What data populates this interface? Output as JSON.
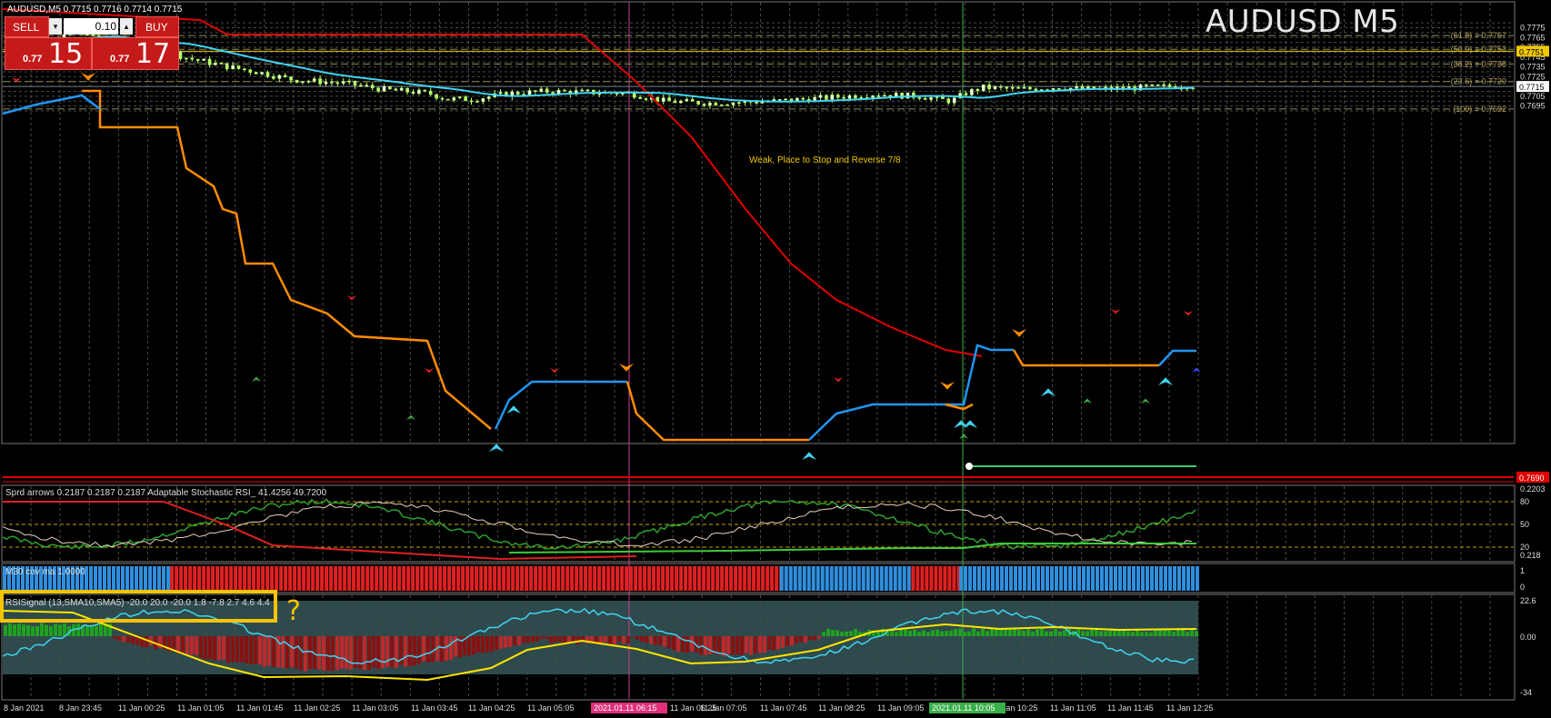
{
  "window": {
    "symbol_line": "AUDUSD,M5  0.7715 0.7716 0.7714 0.7715",
    "watermark": "AUDUSD M5"
  },
  "trade_panel": {
    "sell_label": "SELL",
    "buy_label": "BUY",
    "lot_value": "0.10",
    "sell_price_prefix": "0.77",
    "sell_price_big": "15",
    "buy_price_prefix": "0.77",
    "buy_price_big": "17"
  },
  "main_chart": {
    "price_labels": [
      "0.7775",
      "0.7765",
      "0.7755",
      "0.7745",
      "0.7735",
      "0.7725",
      "0.7705",
      "0.7695"
    ],
    "fib_levels": [
      {
        "text": "(61.8) = 0.7767",
        "price": 0.7767
      },
      {
        "text": "(50.0) = 0.7753",
        "price": 0.7753
      },
      {
        "text": "(38.2) = 0.7738",
        "price": 0.7738
      },
      {
        "text": "(23.6) = 0.7720",
        "price": 0.772
      },
      {
        "text": "(100) = 0.7692",
        "price": 0.7692
      }
    ],
    "current_price": "0.7715",
    "yellow_level": "0.7751",
    "red_level": "0.7690",
    "annotation": "Weak, Place to Stop and Reverse  7/8",
    "colors": {
      "ma_red": "#e00000",
      "ma_cyan": "#3fd4f2",
      "step_orange": "#ff8c00",
      "step_blue": "#2196f3",
      "candle": "#b5ff6a",
      "grid": "#4a4a4a",
      "fib": "#8c8c55",
      "yellow": "#f0c800"
    }
  },
  "stoch": {
    "label": "Sprd arrows 0.2187 0.2187 0.2187  Adaptable Stochastic RSI_ 41.4256 49.7200",
    "axis": [
      "0.2203",
      "80",
      "50",
      "20",
      "0.218"
    ]
  },
  "cov": {
    "label": "M30 cov ma 1.0000",
    "axis": [
      "1",
      "0"
    ],
    "segments": [
      {
        "color": "blue",
        "frac": 0.14
      },
      {
        "color": "red",
        "frac": 0.51
      },
      {
        "color": "blue",
        "frac": 0.11
      },
      {
        "color": "red",
        "frac": 0.04
      },
      {
        "color": "blue",
        "frac": 0.2
      }
    ]
  },
  "rsi": {
    "label": "RSISignal (13,SMA10,SMA5) -20.0 20.0 -20.0 1.8 -7.8 2.7 4.6 4.4",
    "axis": [
      "22.6",
      "0.00",
      "-34"
    ],
    "callout_mark": "?"
  },
  "time_axis": {
    "labels": [
      "8 Jan 2021",
      "8 Jan 23:45",
      "11 Jan 00:25",
      "11 Jan 01:05",
      "11 Jan 01:45",
      "11 Jan 02:25",
      "11 Jan 03:05",
      "11 Jan 03:45",
      "11 Jan 04:25",
      "11 Jan 05:05",
      "",
      "11 Jan 06:25",
      "11 Jan 07:05",
      "11 Jan 07:45",
      "11 Jan 08:25",
      "11 Jan 09:05",
      "",
      "11 Jan 10:25",
      "11 Jan 11:05",
      "11 Jan 11:45",
      "11 Jan 12:25"
    ],
    "highlight_pink": "2021.01.11 06:15",
    "highlight_green": "2021.01.11 10:05"
  }
}
